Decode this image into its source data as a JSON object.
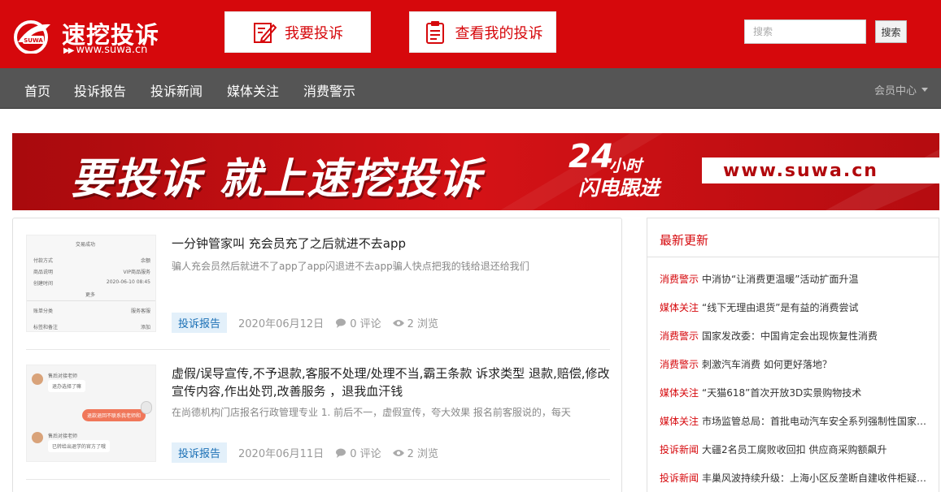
{
  "header": {
    "logo_name": "速挖投诉",
    "logo_url": "www.suwa.cn",
    "logo_badge": "SUWA",
    "complain_button": "我要投诉",
    "my_complaints_button": "查看我的投诉",
    "search_placeholder": "搜索",
    "search_button": "搜索"
  },
  "nav": {
    "items": [
      "首页",
      "投诉报告",
      "投诉新闻",
      "媒体关注",
      "消费警示"
    ],
    "member_center": "会员中心"
  },
  "banner": {
    "headline": "要投诉 就上速挖投诉",
    "badge_number": "24",
    "badge_text_1": "小时",
    "badge_text_2": "闪电跟进",
    "url": "www.suwa.cn"
  },
  "articles": [
    {
      "title": "一分钟管家叫 充会员充了之后就进不去app",
      "summary": "骗人充会员然后就进不了app了app闪退进不去app骗人快点把我的钱给退还给我们",
      "tag": "投诉报告",
      "date": "2020年06月12日",
      "comments": "0 评论",
      "views": "2 浏览",
      "thumb": {
        "header": "交易成功",
        "rows": [
          [
            "付款方式",
            "余额"
          ],
          [
            "商品说明",
            "VIP商品服务"
          ],
          [
            "创建时间",
            "2020-06-10 08:45"
          ]
        ],
        "more": "更多",
        "row_a": "账单分类",
        "row_a_value": "服务客服",
        "row_b": "标签和备注",
        "row_b_value": "添加"
      }
    },
    {
      "title": "虚假/误导宣传,不予退款,客服不处理/处理不当,霸王条款 诉求类型 退款,赔偿,修改宣传内容,作出处罚,改善服务 ，退我血汗钱",
      "summary": "在尚德机构门店报名行政管理专业 1. 前后不一，虚假宣传，夸大效果 报名前客服说的，每天",
      "tag": "投诉报告",
      "date": "2020年06月11日",
      "comments": "0 评论",
      "views": "2 浏览",
      "thumb": {
        "msg1_name": "售后对接老师",
        "msg1_text": "退办选择了嘛",
        "msg2_text": "退款退回不联系我老师和",
        "msg3_name": "售后对接老师",
        "msg3_text": "已转给出退学的官方了哦"
      }
    }
  ],
  "sidebar": {
    "title": "最新更新",
    "news": [
      {
        "cat": "消费警示",
        "text": "中消协“让消费更温暖”活动扩面升温"
      },
      {
        "cat": "媒体关注",
        "text": "“线下无理由退货”是有益的消费尝试"
      },
      {
        "cat": "消费警示",
        "text": "国家发改委：中国肯定会出现恢复性消费"
      },
      {
        "cat": "消费警示",
        "text": "刺激汽车消费 如何更好落地？"
      },
      {
        "cat": "媒体关注",
        "text": "“天猫618”首次开放3D实景购物技术"
      },
      {
        "cat": "媒体关注",
        "text": "市场监管总局：首批电动汽车安全系列强制性国家标准"
      },
      {
        "cat": "投诉新闻",
        "text": "大疆2名员工腐败收回扣 供应商采购额飙升"
      },
      {
        "cat": "投诉新闻",
        "text": "丰巢风波持续升级：上海小区反垄断自建收件柜疑遭封杀"
      }
    ]
  },
  "colors": {
    "brand_red": "#d6080c",
    "nav_gray": "#555555",
    "tag_blue": "#1a6fb5"
  }
}
